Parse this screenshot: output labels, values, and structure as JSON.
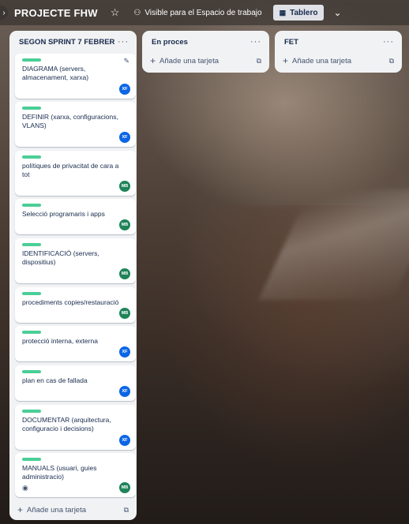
{
  "header": {
    "edge_arrow": "›",
    "board_title": "PROJECTE FHW",
    "star_icon": "☆",
    "visibility_icon": "⚇",
    "visibility_label": "Visible para el Espacio de trabajo",
    "view_icon": "▦",
    "view_label": "Tablero",
    "chevron": "⌄"
  },
  "colors": {
    "label_green": "#4bce97",
    "avatar_xf": "#0c66e4",
    "avatar_mb": "#1f845a"
  },
  "lists": [
    {
      "title": "SEGON SPRINT 7 FEBRER",
      "menu": "···",
      "add_label": "Añade una tarjeta",
      "cards": [
        {
          "title": "DIAGRAMA (servers, almacenament, xarxa)",
          "avatar": "XF"
        },
        {
          "title": "DEFINIR (xarxa, configuracions, VLANS)",
          "avatar": "XF"
        },
        {
          "title": "polítiques de privacitat de cara a tot",
          "avatar": "MB"
        },
        {
          "title": "Selecció programaris i apps",
          "avatar": "MB"
        },
        {
          "title": "IDENTIFICACIÓ (servers, dispositius)",
          "avatar": "MB"
        },
        {
          "title": "procediments copies/restauració",
          "avatar": "MB"
        },
        {
          "title": "protecció interna, externa",
          "avatar": "XF"
        },
        {
          "title": "plan en cas de fallada",
          "avatar": "XF"
        },
        {
          "title": "DOCUMENTAR (arquitectura, configuracio i decisions)",
          "avatar": "XF"
        },
        {
          "title": "MANUALS (usuari, guies administracio)",
          "avatar": "MB"
        }
      ]
    },
    {
      "title": "En proces",
      "menu": "···",
      "add_label": "Añade una tarjeta"
    },
    {
      "title": "FET",
      "menu": "···",
      "add_label": "Añade una tarjeta"
    }
  ],
  "icons": {
    "plus": "+",
    "template": "⧉",
    "edit": "✎",
    "eye": "◉"
  }
}
